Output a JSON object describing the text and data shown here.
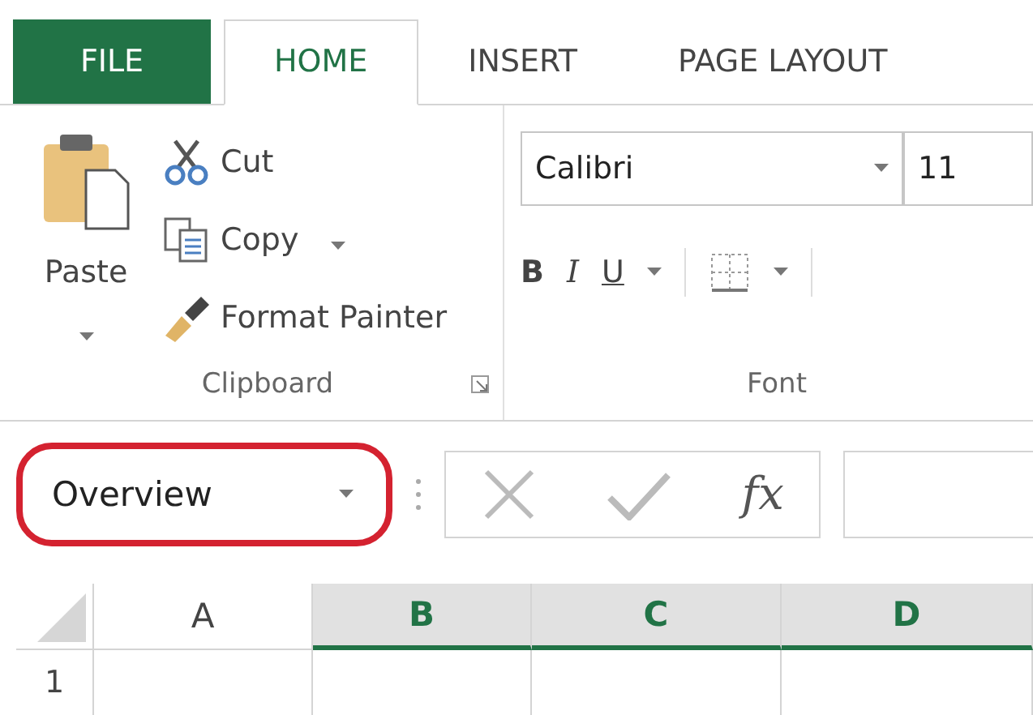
{
  "tabs": [
    {
      "label": "FILE",
      "kind": "file",
      "selected": false
    },
    {
      "label": "HOME",
      "kind": "tab",
      "selected": true
    },
    {
      "label": "INSERT",
      "kind": "tab",
      "selected": false
    },
    {
      "label": "PAGE LAYOUT",
      "kind": "tab",
      "selected": false
    }
  ],
  "clipboard": {
    "paste": "Paste",
    "items": [
      {
        "label": "Cut",
        "kind": "cut",
        "dropdown": false
      },
      {
        "label": "Copy",
        "kind": "copy",
        "dropdown": true
      },
      {
        "label": "Format Painter",
        "kind": "painter",
        "dropdown": false
      }
    ],
    "group_label": "Clipboard"
  },
  "font": {
    "font_name": "Calibri",
    "font_size": "11",
    "buttons": [
      "B",
      "I",
      "U"
    ],
    "group_label": "Font"
  },
  "name_box": {
    "value": "Overview",
    "highlighted": true
  },
  "function_label": "fx",
  "columns": [
    {
      "label": "A",
      "selected": false
    },
    {
      "label": "B",
      "selected": true
    },
    {
      "label": "C",
      "selected": true
    },
    {
      "label": "D",
      "selected": true
    }
  ],
  "rows": [
    "1"
  ]
}
